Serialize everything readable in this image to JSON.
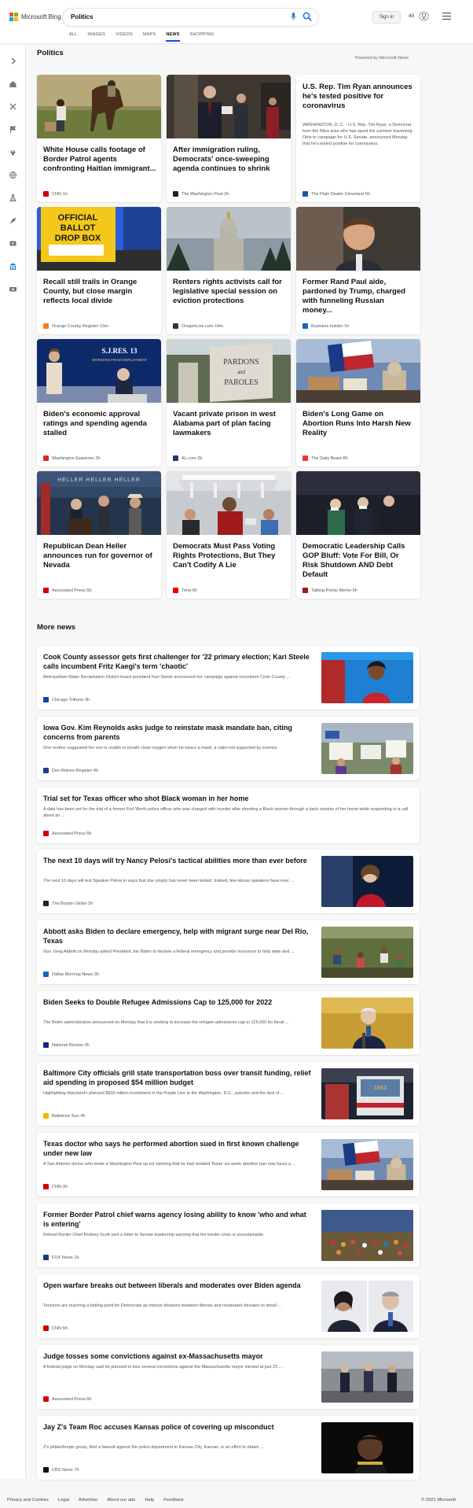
{
  "brand": {
    "name": "Microsoft Bing",
    "tile_colors": [
      "#f25022",
      "#7fba00",
      "#00a4ef",
      "#ffb900"
    ]
  },
  "search": {
    "query": "Politics"
  },
  "tabs": [
    "ALL",
    "IMAGES",
    "VIDEOS",
    "MAPS",
    "NEWS",
    "SHOPPING"
  ],
  "active_tab": "NEWS",
  "header": {
    "sign_in": "Sign in",
    "points": "40"
  },
  "sidebar_icons": [
    "chevron-right-icon",
    "home-icon",
    "sports-icon",
    "flag-icon",
    "location-icon",
    "globe-icon",
    "science-icon",
    "rocket-icon",
    "entertainment-icon",
    "government-icon",
    "money-icon"
  ],
  "section": {
    "title": "Politics",
    "powered_by": "Powered by Microsoft News"
  },
  "cards": [
    {
      "title": "White House calls footage of Border Patrol agents confronting Haitian immigrant...",
      "source": "CNN",
      "time": "1h",
      "img": "border"
    },
    {
      "title": "After immigration ruling, Democrats' once-sweeping agenda continues to shrink",
      "source": "The Washington Post",
      "time": "2h",
      "img": "schumer"
    },
    {
      "title": "U.S. Rep. Tim Ryan announces he's tested positive for coronavirus",
      "summary": "WASHINGTON, D. C. - U.S. Rep. Tim Ryan, a Democrat from the Niles area who has spent the summer traversing Ohio to campaign for U.S. Senate, announced Monday that he's tested positive for coronavirus.",
      "source": "The Plain Dealer Cleveland",
      "time": "5h",
      "img": ""
    },
    {
      "title": "Recall still trails in Orange County, but close margin reflects local divide",
      "source": "Orange County Register",
      "time": "16m",
      "img": "ballot"
    },
    {
      "title": "Renters rights activists call for legislative special session on eviction protections",
      "source": "OregonLive.com",
      "time": "14m",
      "img": "capitol"
    },
    {
      "title": "Former Rand Paul aide, pardoned by Trump, charged with funneling Russian money...",
      "source": "Business Insider",
      "time": "1h",
      "img": "portrait"
    },
    {
      "title": "Biden's economic approval ratings and spending agenda stalled",
      "source": "Washington Examiner",
      "time": "2h",
      "img": "biden_pelosi"
    },
    {
      "title": "Vacant private prison in west Alabama part of plan facing lawmakers",
      "source": "AL.com",
      "time": "3h",
      "img": "pardons"
    },
    {
      "title": "Biden's Long Game on Abortion Runs Into Harsh New Reality",
      "source": "The Daily Beast",
      "time": "8h",
      "img": "texas"
    },
    {
      "title": "Republican Dean Heller announces run for governor of Nevada",
      "source": "Associated Press",
      "time": "5h",
      "img": "heller"
    },
    {
      "title": "Democrats Must Pass Voting Rights Protections, But They Can't Codify A Lie",
      "source": "Time",
      "time": "6h",
      "img": "rally"
    },
    {
      "title": "Democratic Leadership Calls GOP Bluff: Vote For Bill, Or Risk Shutdown AND Debt Default",
      "source": "Talking Points Memo",
      "time": "5h",
      "img": "leaders"
    }
  ],
  "card_images": {
    "pardons": {
      "sign_line1": "PARDONS",
      "sign_line2": "and",
      "sign_line3": "PAROLES"
    },
    "biden_pelosi": {
      "banner": "S.J.RES. 13",
      "sub": "WORKERS FROM EMPLOYMENT"
    },
    "ballot": {
      "line1": "OFFICIAL",
      "line2": "BALLOT",
      "line3": "DROP BOX"
    }
  },
  "more_news_title": "More news",
  "more_news": [
    {
      "title": "Cook County assessor gets first challenger for '22 primary election; Kari Steele calls incumbent Fritz Kaegi's term 'chaotic'",
      "desc": "Metropolitan Water Reclamation District board president Kari Steele announced her campaign against incumbent Cook County ...",
      "source": "Chicago Tribune",
      "time": "3h",
      "img": "steele"
    },
    {
      "title": "Iowa Gov. Kim Reynolds asks judge to reinstate mask mandate ban, citing concerns from parents",
      "desc": "One mother suggested her son is unable to breath clean oxygen when he wears a mask, a claim not supported by science.",
      "source": "Des Moines Register",
      "time": "4h",
      "img": "protest"
    },
    {
      "title": "Trial set for Texas officer who shot Black woman in her home",
      "desc": "A date has been set for the trial of a former Fort Worth police officer who was charged with murder after shooting a Black woman through a back window of her home while responding to a call about an ...",
      "source": "Associated Press",
      "time": "5h",
      "img": ""
    },
    {
      "title": "The next 10 days will try Nancy Pelosi's tactical abilities more than ever before",
      "desc": "The next 10 days will test Speaker Pelosi in ways that she simply has never been tested. Indeed, few House speakers have ever ...",
      "source": "The Boston Globe",
      "time": "2h",
      "img": "pelosi"
    },
    {
      "title": "Abbott asks Biden to declare emergency, help with migrant surge near Del Rio, Texas",
      "desc": "Gov. Greg Abbott on Monday asked President Joe Biden to declare a federal emergency and provide resources to help state and ...",
      "source": "Dallas Morning News",
      "time": "3h",
      "img": "migrants"
    },
    {
      "title": "Biden Seeks to Double Refugee Admissions Cap to 125,000 for 2022",
      "desc": "The Biden administration announced on Monday that it is seeking to increase the refugee-admissions cap to 125,000 for fiscal ...",
      "source": "National Review",
      "time": "3h",
      "img": "biden"
    },
    {
      "title": "Baltimore City officials grill state transportation boss over transit funding, relief aid spending in proposed $54 million budget",
      "desc": "Highlighting Maryland's planned $500 million investment in the Purple Line in the Washington, D.C., suburbs and the lack of ...",
      "source": "Baltimore Sun",
      "time": "4h",
      "img": "bus"
    },
    {
      "title": "Texas doctor who says he performed abortion sued in first known challenge under new law",
      "desc": "A San Antonio doctor who wrote a Washington Post op-ed claiming that he had violated Texas' six-week abortion ban now faces a ...",
      "source": "CNN",
      "time": "3h",
      "img": "texas2"
    },
    {
      "title": "Former Border Patrol chief warns agency losing ability to know 'who and what is entering'",
      "desc": "Retired Border Chief Rodney Scott sent a letter to Senate leadership warning that the border crisis is unsustainable.",
      "source": "FOX News",
      "time": "1h",
      "img": "crowd"
    },
    {
      "title": "Open warfare breaks out between liberals and moderates over Biden agenda",
      "desc": "Tensions are reaching a boiling point for Democrats as intense divisions between liberals and moderates threaten to derail ...",
      "source": "CNN",
      "time": "5h",
      "img": "split"
    },
    {
      "title": "Judge tosses some convictions against ex-Massachusetts mayor",
      "desc": "A federal judge on Monday said he planned to toss several convictions against the Massachusetts mayor elected at just 23 ...",
      "source": "Associated Press",
      "time": "6h",
      "img": "walkers"
    },
    {
      "title": "Jay Z's Team Roc accuses Kansas police of covering up misconduct",
      "desc": "Z's philanthropic group, filed a lawsuit against the police department in Kansas City, Kansas, in an effort to obtain ...",
      "source": "CBS News",
      "time": "7h",
      "img": "jayz"
    }
  ],
  "footer": {
    "links": [
      "Privacy and Cookies",
      "Legal",
      "Advertise",
      "About our ads",
      "Help",
      "Feedback"
    ],
    "copyright": "© 2021 Microsoft"
  },
  "source_colors": {
    "CNN": "#cc0000",
    "The Washington Post": "#222222",
    "The Plain Dealer Cleveland": "#1a5aa6",
    "Orange County Register": "#f57c20",
    "OregonLive.com": "#333333",
    "Business Insider": "#1565c0",
    "Washington Examiner": "#d32f2f",
    "AL.com": "#1f3b6e",
    "The Daily Beast": "#e53935",
    "Associated Press": "#d50000",
    "Time": "#e30000",
    "Talking Points Memo": "#9e1b1b",
    "Chicago Tribune": "#0d47a1",
    "Des Moines Register": "#1e3f8f",
    "The Boston Globe": "#222222",
    "Dallas Morning News": "#1565c0",
    "National Review": "#1a237e",
    "Baltimore Sun": "#f5b400",
    "FOX News": "#1a3a73",
    "CBS News": "#111111"
  }
}
